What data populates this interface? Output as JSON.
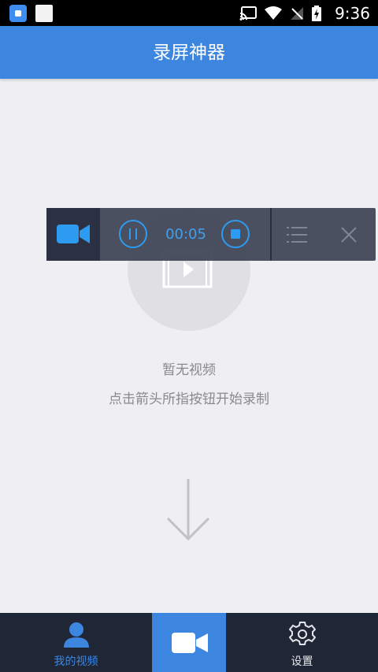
{
  "status_bar": {
    "time": "9:36",
    "icons": [
      "cast-icon",
      "wifi-icon",
      "no-signal-icon",
      "battery-charging-icon"
    ]
  },
  "header": {
    "title": "录屏神器"
  },
  "empty_state": {
    "title": "暂无视频",
    "hint": "点击箭头所指按钮开始录制"
  },
  "recorder": {
    "elapsed": "00:05",
    "icons": [
      "video-camera-icon",
      "pause-icon",
      "stop-icon",
      "menu-icon",
      "close-icon"
    ]
  },
  "bottom_nav": {
    "items": [
      {
        "label": "我的视频",
        "icon": "person-icon",
        "active": true
      },
      {
        "label": "",
        "icon": "video-camera-icon"
      },
      {
        "label": "设置",
        "icon": "gear-icon"
      }
    ]
  },
  "colors": {
    "accent": "#3d86e0",
    "recorder_bg": "#3c4252",
    "nav_bg": "#1f2636",
    "timer": "#3fa0f0"
  }
}
